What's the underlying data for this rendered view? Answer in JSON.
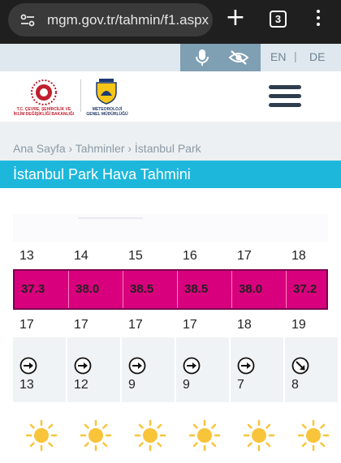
{
  "browser": {
    "url": "mgm.gov.tr/tahmin/f1.aspx",
    "tab_count": "3"
  },
  "accessibility": {
    "lang_en": "EN",
    "lang_sep": "|",
    "lang_de": "DE"
  },
  "header": {
    "ministry_logo_text": "T.C. ÇEVRE, ŞEHİRCİLİK VE İKLİM DEĞİŞİKLİĞİ BAKANLIĞI",
    "mgm_logo_top": "METEOROLOJİ",
    "mgm_logo_text": "METEOROLOJİ GENEL MÜDÜRLÜĞÜ"
  },
  "breadcrumb": {
    "text": "Ana Sayfa › Tahminler › İstanbul Park"
  },
  "page": {
    "title": "İstanbul Park Hava Tahmini"
  },
  "forecast": {
    "hours": [
      "13",
      "14",
      "15",
      "16",
      "17",
      "18"
    ],
    "max_temps": [
      "37.3",
      "38.0",
      "38.5",
      "38.5",
      "38.0",
      "37.2"
    ],
    "min_temps": [
      "17",
      "17",
      "17",
      "17",
      "18",
      "19"
    ],
    "wind_directions": [
      "east",
      "east",
      "east",
      "east",
      "east",
      "south-east"
    ],
    "wind_speeds": [
      "13",
      "12",
      "9",
      "9",
      "7",
      "8"
    ],
    "conditions": [
      "sunny",
      "sunny",
      "sunny",
      "sunny",
      "sunny",
      "sunny"
    ]
  },
  "colors": {
    "title_bar": "#1db7dc",
    "max_temp_band": "#d9007d",
    "accessibility_button": "#7f9fb3"
  }
}
